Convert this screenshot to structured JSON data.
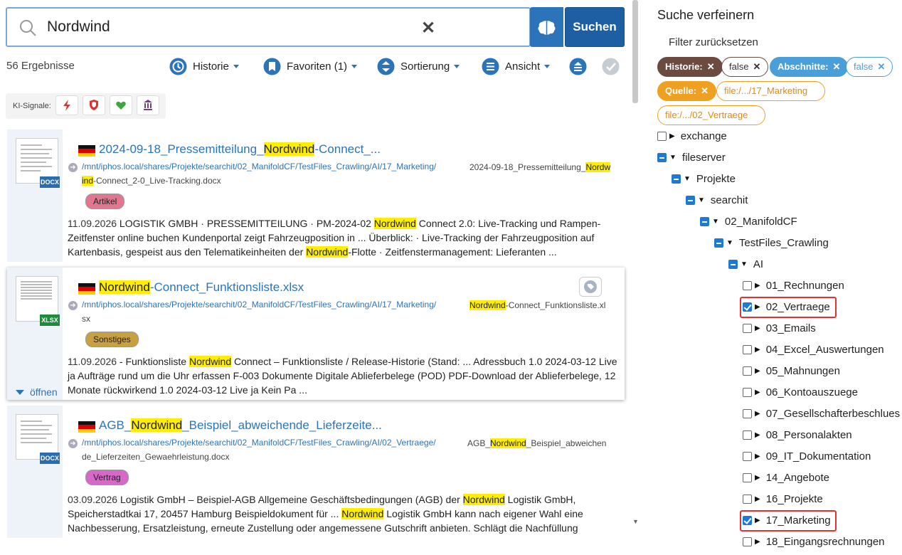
{
  "search": {
    "query": "Nordwind",
    "button_label": "Suchen"
  },
  "results_count": "56 Ergebnisse",
  "toolbar": {
    "history": "Historie",
    "favorites": "Favoriten (1)",
    "sort": "Sortierung",
    "view": "Ansicht"
  },
  "ki_signals": {
    "label": "KI-Signale:"
  },
  "results": [
    {
      "title_pre": "2024-09-18_Pressemitteilung_",
      "title_hl": "Nordwind",
      "title_post": "-Connect_...",
      "path": "/mnt/iphos.local/shares/Projekte/searchit/02_ManifoldCF/TestFiles_Crawling/AI/17_Marketing/",
      "fname_pre": "2024-09-18_Pressemitteilung_",
      "fname_hl": "Nordw",
      "path2_hl": "ind",
      "path2_post": "-Connect_2-0_Live-Tracking.docx",
      "tag": "Artikel",
      "tag_color": "#e0778f",
      "file_type": "DOCX",
      "file_color": "#2b6cb0",
      "date": "11.09.2026",
      "snip_1": " LOGISTIK GMBH · PRESSEMITTEILUNG · PM-2024-02 ",
      "snip_hl1": "Nordwind",
      "snip_2": " Connect 2.0: Live-Tracking und Rampen-Zeitfenster online buchen Kundenportal zeigt Fahrzeugposition in ... Überblick: · Live-Tracking der Fahrzeugposition auf Kartenbasis, gespeist aus den Telematikeinheiten der ",
      "snip_hl2": "Nordwind",
      "snip_3": "-Flotte · Zeitfenstermanagement: Lieferanten ..."
    },
    {
      "title_pre": "",
      "title_hl": "Nordwind",
      "title_post": "-Connect_Funktionsliste.xlsx",
      "path": "/mnt/iphos.local/shares/Projekte/searchit/02_ManifoldCF/TestFiles_Crawling/AI/17_Marketing/",
      "fname_pre": "",
      "fname_hl": "Nordwind",
      "fname_post": "-Connect_Funktionsliste.xl",
      "path2_post": "sx",
      "tag": "Sonstiges",
      "tag_color": "#c9a040",
      "file_type": "XLSX",
      "file_color": "#1e8a3c",
      "date": "11.09.2026",
      "snip_1": " - Funktionsliste ",
      "snip_hl1": "Nordwind",
      "snip_2": " Connect – Funktionsliste / Release-Historie (Stand: ... Adressbuch 1.0 2024-03-12 Live ja Aufträge rund um die Uhr erfassen F-003 Dokumente Digitale Ablieferbelege (POD) PDF-Download der Ablieferbelege, 12 Monate rückwirkend 1.0 2024-03-12 Live ja Kein Pa ...",
      "open_label": "öffnen"
    },
    {
      "title_pre": "AGB_",
      "title_hl": "Nordwind",
      "title_post": "_Beispiel_abweichende_Lieferzeite...",
      "path": "/mnt/iphos.local/shares/Projekte/searchit/02_ManifoldCF/TestFiles_Crawling/AI/02_Vertraege/",
      "fname_pre": "AGB_",
      "fname_hl": "Nordwind",
      "fname_post": "_Beispiel_abweichen",
      "path2_post": "de_Lieferzeiten_Gewaehrleistung.docx",
      "tag": "Vertrag",
      "tag_color": "#d868c8",
      "file_type": "DOCX",
      "file_color": "#2b6cb0",
      "date": "03.09.2026",
      "snip_1": " Logistik GmbH – Beispiel-AGB Allgemeine Geschäftsbedingungen (AGB) der ",
      "snip_hl1": "Nordwind",
      "snip_2": " Logistik GmbH, Speicherstadtkai 17, 20457 Hamburg Beispieldokument für ... ",
      "snip_hl2": "Nordwind",
      "snip_3": " Logistik GmbH kann nach eigener Wahl eine Nachbesserung, Ersatzleistung, erneute Zustellung oder angemessene Gutschrift anbieten. Schlägt die Nachfüllung"
    }
  ],
  "refine": {
    "heading": "Suche verfeinern",
    "reset": "Filter zurücksetzen",
    "chips": [
      {
        "label": "Historie:",
        "value": "false"
      },
      {
        "label": "Abschnitte:",
        "value": "false"
      },
      {
        "label": "Quelle:",
        "value1": "file:/.../17_Marketing",
        "value2": "file:/.../02_Vertraege"
      }
    ],
    "tree": [
      "exchange",
      "fileserver",
      "Projekte",
      "searchit",
      "02_ManifoldCF",
      "TestFiles_Crawling",
      "AI",
      "01_Rechnungen",
      "02_Vertraege",
      "03_Emails",
      "04_Excel_Auswertungen",
      "05_Mahnungen",
      "06_Kontoauszuege",
      "07_Gesellschafterbeschlues",
      "08_Personalakten",
      "09_IT_Dokumentation",
      "14_Angebote",
      "16_Projekte",
      "17_Marketing",
      "18_Eingangsrechnungen"
    ]
  },
  "colors": {
    "accent": "#2b74b9",
    "highlight": "#ffee00",
    "history_chip": "#6b4a40",
    "sections_chip": "#4a9fd8",
    "source_chip": "#f0a020"
  }
}
